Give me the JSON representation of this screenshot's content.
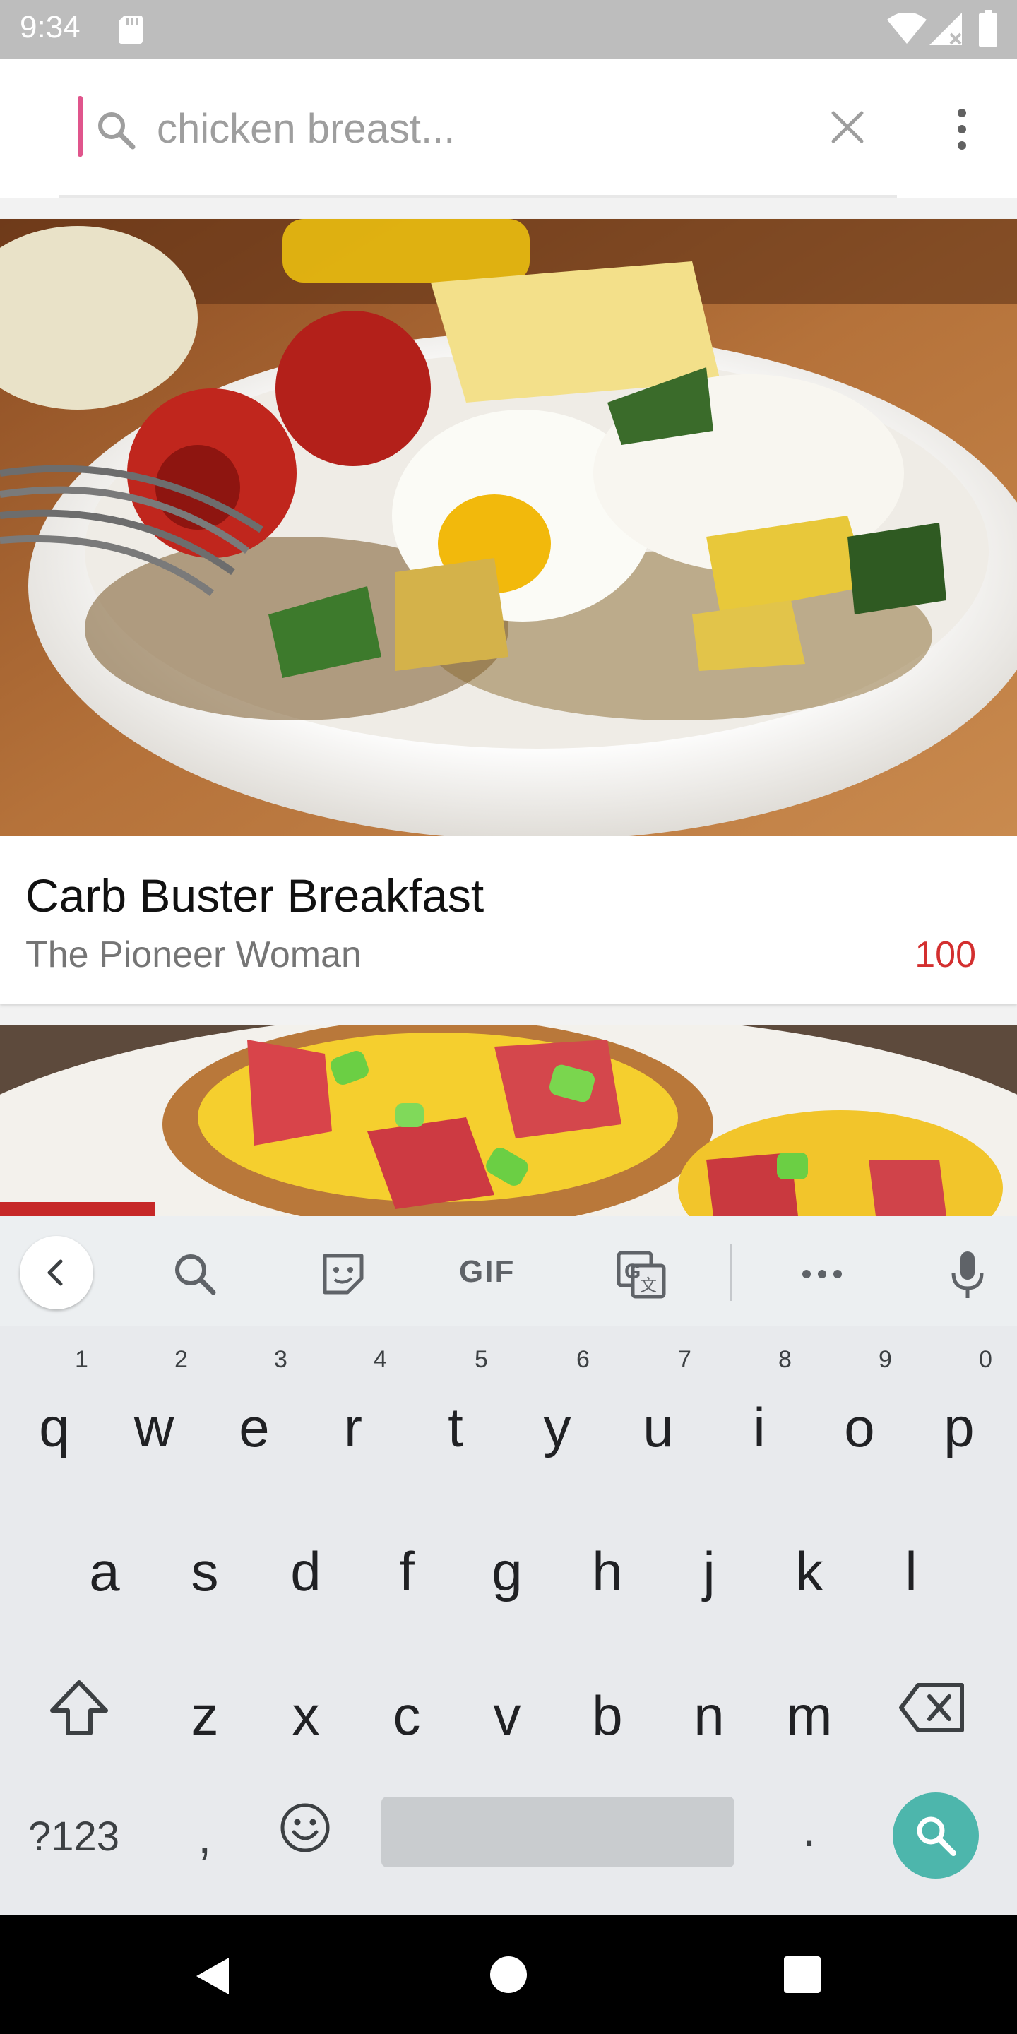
{
  "status_bar": {
    "time": "9:34"
  },
  "search": {
    "placeholder": "chicken breast..."
  },
  "recipes": [
    {
      "title": "Carb Buster Breakfast",
      "source": "The Pioneer Woman",
      "score": "100"
    }
  ],
  "keyboard": {
    "gif_label": "GIF",
    "row1": [
      "q",
      "w",
      "e",
      "r",
      "t",
      "y",
      "u",
      "i",
      "o",
      "p"
    ],
    "row1_hints": [
      "1",
      "2",
      "3",
      "4",
      "5",
      "6",
      "7",
      "8",
      "9",
      "0"
    ],
    "row2": [
      "a",
      "s",
      "d",
      "f",
      "g",
      "h",
      "j",
      "k",
      "l"
    ],
    "row3": [
      "z",
      "x",
      "c",
      "v",
      "b",
      "n",
      "m"
    ],
    "symbols_label": "?123",
    "comma": ",",
    "period": "."
  },
  "colors": {
    "accent": "#e0558c",
    "score": "#d32f2f",
    "enter": "#4db6ac"
  }
}
